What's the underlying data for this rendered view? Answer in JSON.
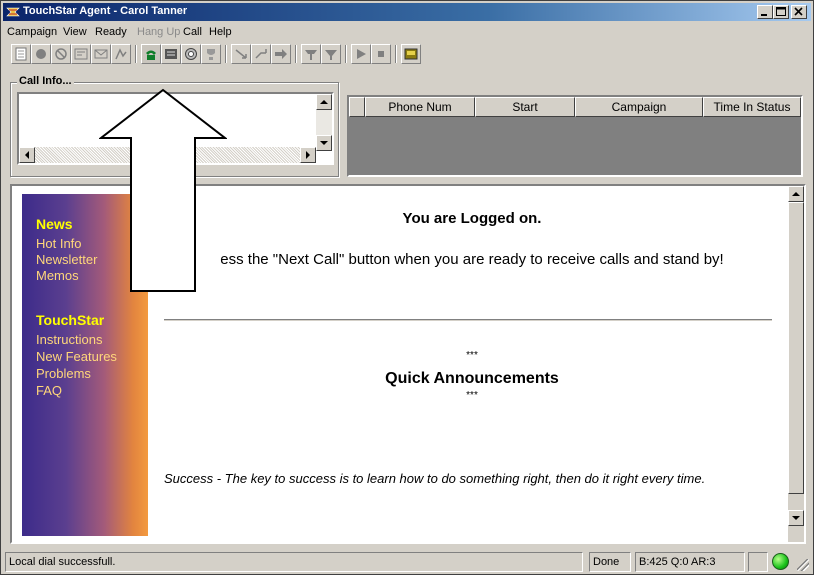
{
  "window": {
    "title": "TouchStar Agent - Carol Tanner"
  },
  "menu": [
    {
      "label": "Campaign"
    },
    {
      "label": "View"
    },
    {
      "label": "Ready"
    },
    {
      "label": "Hang Up"
    },
    {
      "label": "Call"
    },
    {
      "label": "Help"
    }
  ],
  "toolbar": {
    "icons": [
      "note-icon",
      "record-icon",
      "stop-icon",
      "form-icon",
      "mail-icon",
      "skip-icon",
      "phone-icon",
      "drawer-icon",
      "settings-icon",
      "trophy-icon",
      "transfer-icon",
      "hold-icon",
      "forward-icon",
      "conference-icon",
      "join-icon",
      "play-icon",
      "stop-square-icon",
      "save-icon"
    ]
  },
  "call_info": {
    "label": "Call Info...",
    "text": ""
  },
  "phone_grid": {
    "columns": [
      "",
      "Phone Num",
      "Start",
      "Campaign",
      "Time In Status"
    ]
  },
  "sidebar": {
    "sections": [
      {
        "heading": "News",
        "links": [
          "Hot Info",
          "Newsletter",
          "Memos"
        ]
      },
      {
        "heading": "TouchStar",
        "links": [
          "Instructions",
          "New Features",
          "Problems",
          "FAQ"
        ]
      }
    ]
  },
  "content": {
    "title": "You are Logged on.",
    "press_text": "ess the \"Next Call\" button when you are ready to receive calls and stand by!",
    "stars_top": "***",
    "announcements_heading": "Quick Announcements",
    "stars_bottom": "***",
    "success_text": "Success - The key to success is to learn how to do something right, then do it right every time."
  },
  "status": {
    "message": "Local dial successfull.",
    "done": "Done",
    "counts": "B:425 Q:0 AR:3",
    "indicator_color": "#19c21a"
  },
  "colors": {
    "titlebar": "#0a246a",
    "sidebar_heading": "#ffff00",
    "sidebar_link": "#ffd77a"
  }
}
